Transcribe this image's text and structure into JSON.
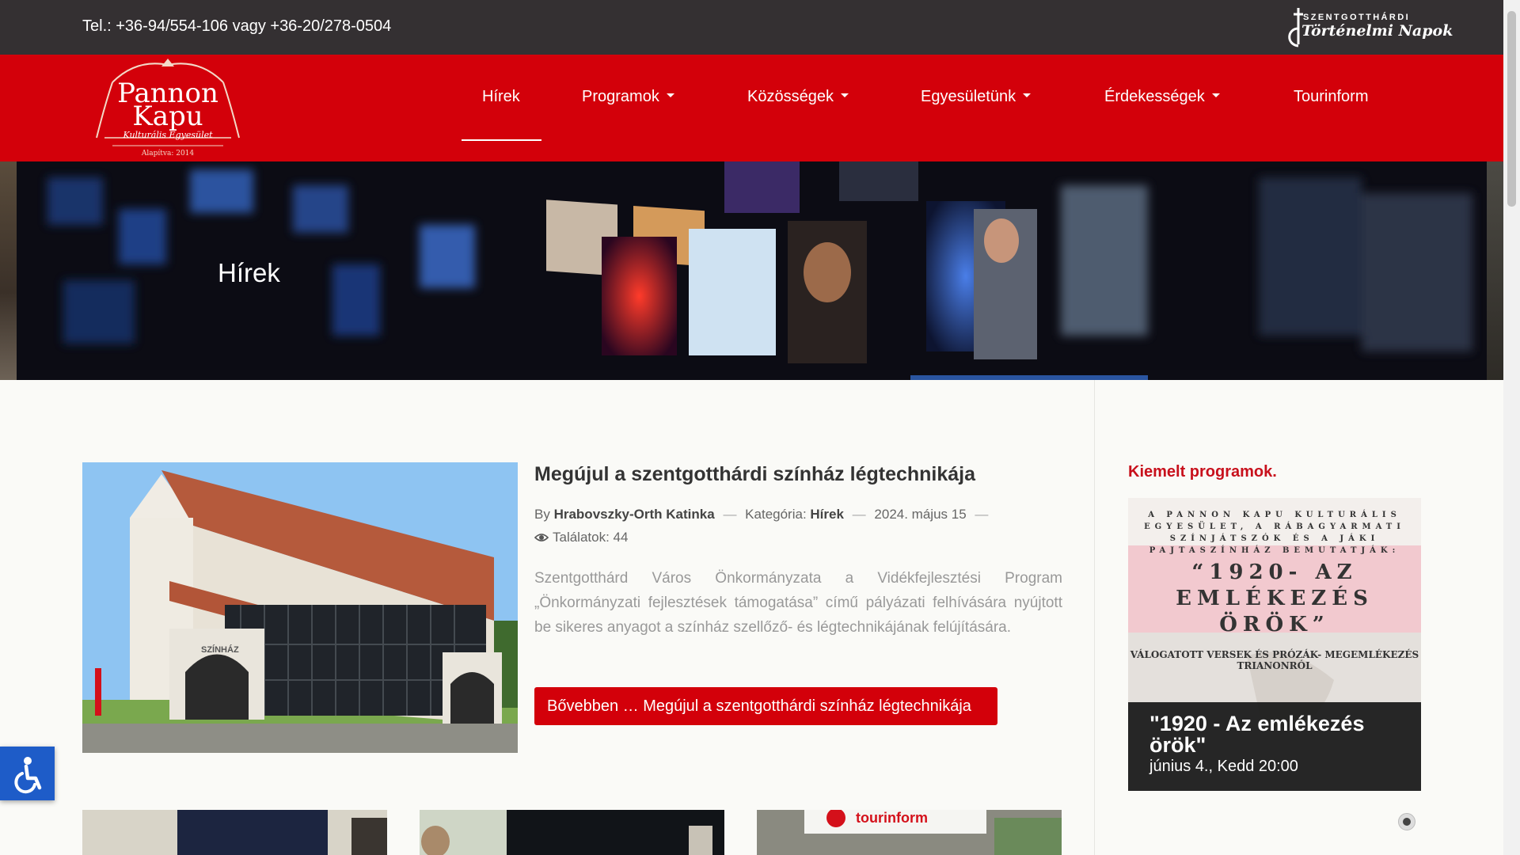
{
  "topbar": {
    "phone": "Tel.: +36-94/554-106 vagy +36-20/278-0504",
    "logo_small": "SZENTGOTTHÁRDI",
    "logo_big": "Történelmi Napok"
  },
  "brand": {
    "line1": "Pannon",
    "line2": "Kapu",
    "subtitle": "Kulturális Egyesület",
    "founded": "Alapítva: 2014"
  },
  "nav": [
    {
      "label": "Hírek"
    },
    {
      "label": "Programok"
    },
    {
      "label": "Közösségek"
    },
    {
      "label": "Egyesületünk"
    },
    {
      "label": "Érdekességek"
    },
    {
      "label": "Tourinform"
    }
  ],
  "hero": {
    "title": "Hírek"
  },
  "article": {
    "title": "Megújul a szentgotthárdi színház légtechnikája",
    "by": "By",
    "author": "Hrabovszky-Orth Katinka",
    "category_label": "Kategória:",
    "category": "Hírek",
    "date": "2024. május 15",
    "hits": "Találatok: 44",
    "excerpt": "Szentgotthárd Város Önkormányzata a Vidékfejlesztési Program „Önkormányzati fejlesztések támogatása” című pályázati felhívására nyújtott be sikeres anyagot a színház szellőző- és légtechnikájának felújítására.",
    "readmore": "Bővebben … Megújul a szentgotthárdi színház légtechnikája",
    "building_sign": "SZÍNHÁZ"
  },
  "thumb3_sign": "tourinform",
  "sidebar": {
    "featured_title": "Kiemelt programok.",
    "poster_intro": "A PANNON KAPU KULTURÁLIS EGYESÜLET, A RÁBAGYARMATI SZÍNJÁTSZÓK ÉS A JÁKI PAJTASZÍNHÁZ BEMUTATJÁK:",
    "poster_quote": "“1920- AZ EMLÉKEZÉS ÖRÖK”",
    "poster_sub": "VÁLOGATOTT VERSEK ÉS PRÓZÁK- MEGEMLÉKEZÉS TRIANONRÓL",
    "caption_title": "\"1920 - Az emlékezés örök\"",
    "caption_date": "június 4., Kedd 20:00"
  },
  "icons": {
    "eye": "eye-icon",
    "accessibility": "accessibility-icon",
    "caret": "chevron-down-icon"
  },
  "colors": {
    "brand_red": "#d3000a",
    "topbar": "#343032",
    "accessibility_blue": "#1e5cc8"
  }
}
